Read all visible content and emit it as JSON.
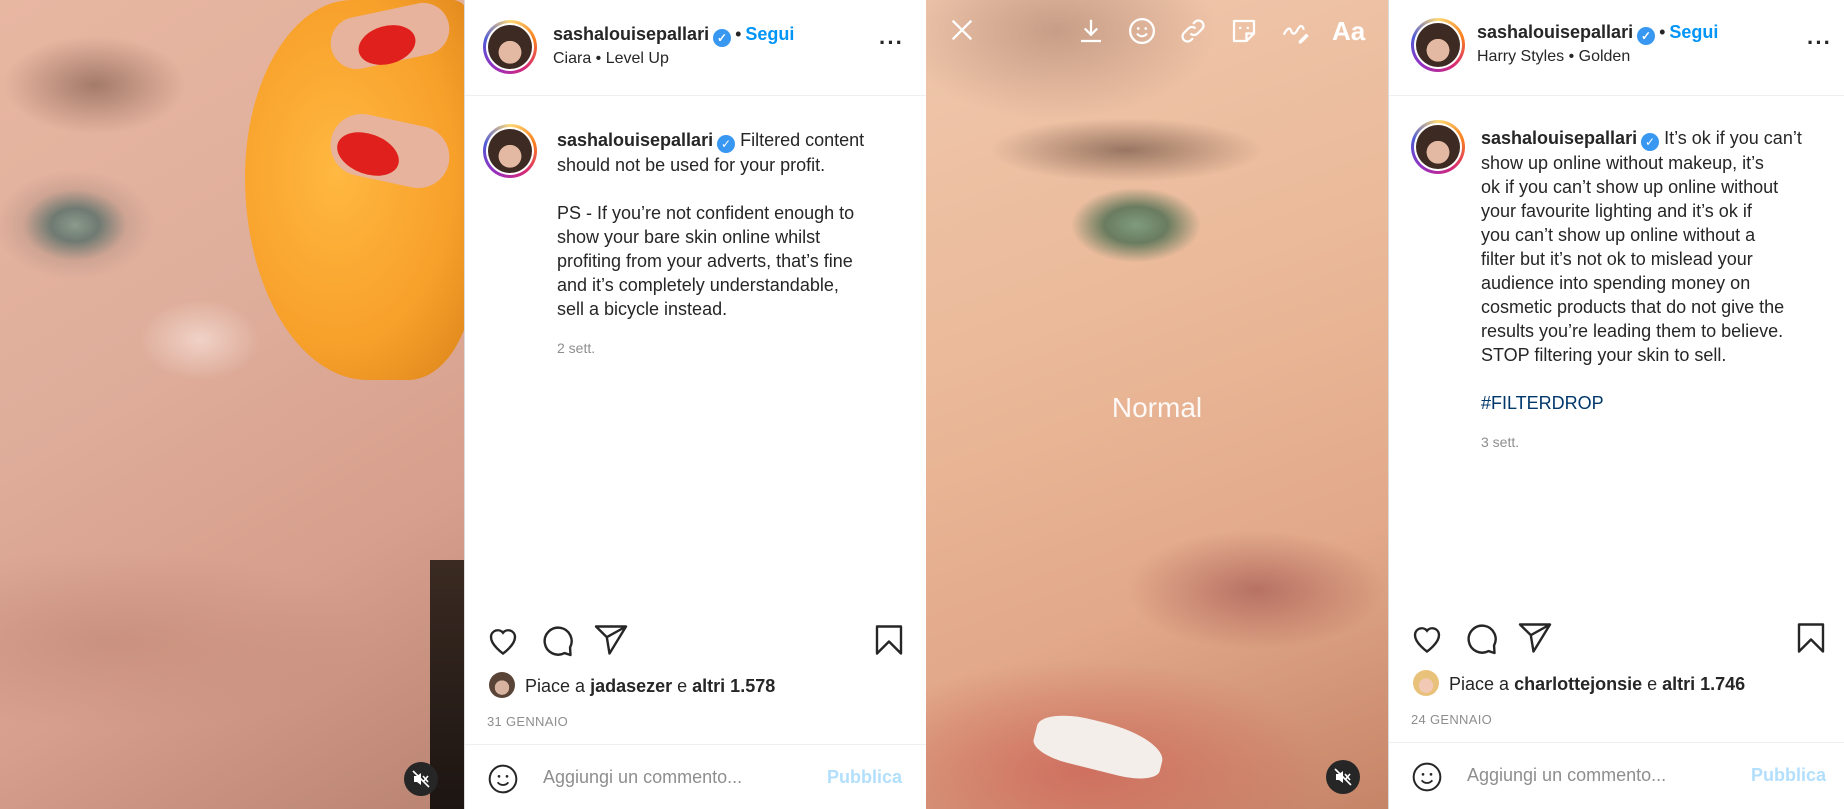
{
  "left_media": {
    "mute_icon": "speaker-muted-icon"
  },
  "post1": {
    "username": "sashalouisepallari",
    "verified_icon": "verified-badge-icon",
    "separator": "•",
    "follow_label": "Segui",
    "music": "Ciara • Level Up",
    "more_icon": "more-options-icon",
    "caption_user": "sashalouisepallari",
    "caption_lines": [
      "Filtered content",
      "should not be used for your profit.",
      "",
      "PS - If you’re not confident enough to",
      "show your bare skin online whilst",
      "profiting from your adverts, that’s fine",
      "and it’s completely understandable,",
      "sell a bicycle instead."
    ],
    "time_ago": "2 sett.",
    "likes_prefix": "Piace a",
    "likes_user": "jadasezer",
    "likes_conj": "e",
    "likes_others": "altri 1.578",
    "date": "31 GENNAIO",
    "comment_placeholder": "Aggiungi un commento...",
    "publish_label": "Pubblica"
  },
  "story_editor": {
    "close_icon": "close-icon",
    "tools": [
      "download-icon",
      "face-sticker-icon",
      "link-icon",
      "sticker-icon",
      "draw-icon"
    ],
    "text_tool_label": "Aa",
    "filter_label": "Normal",
    "mute_icon": "speaker-muted-icon"
  },
  "post2": {
    "username": "sashalouisepallari",
    "separator": "•",
    "follow_label": "Segui",
    "music": "Harry Styles • Golden",
    "caption_user": "sashalouisepallari",
    "caption_lines": [
      "It’s ok if you can’t",
      "show up online without makeup, it’s",
      "ok if you can’t show up online without",
      "your favourite lighting and it’s ok if",
      "you can’t show up online without a",
      "filter but it’s not ok to mislead your",
      "audience into spending money on",
      "cosmetic products that do not give the",
      "results you’re leading them to believe.",
      "STOP filtering your skin to sell."
    ],
    "hashtag": "#FILTERDROP",
    "time_ago": "3 sett.",
    "likes_prefix": "Piace a",
    "likes_user": "charlottejonsie",
    "likes_conj": "e",
    "likes_others": "altri 1.746",
    "date": "24 GENNAIO",
    "comment_placeholder": "Aggiungi un commento...",
    "publish_label": "Pubblica"
  },
  "colors": {
    "accent": "#0095f6",
    "publish_disabled": "#b2dffc",
    "muted_text": "#8e8e8e",
    "verified": "#3897f0"
  }
}
